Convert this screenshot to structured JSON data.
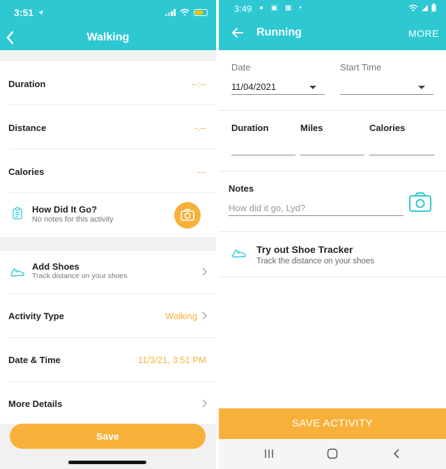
{
  "left_screen": {
    "status_time": "3:51",
    "title": "Walking",
    "rows": {
      "duration": {
        "label": "Duration",
        "value": "--:--"
      },
      "distance": {
        "label": "Distance",
        "value": "-.--"
      },
      "calories": {
        "label": "Calories",
        "value": "---"
      },
      "how": {
        "label": "How Did It Go?",
        "sub": "No notes for this activity"
      },
      "shoes": {
        "label": "Add Shoes",
        "sub": "Track distance on your shoes"
      },
      "activity_type": {
        "label": "Activity Type",
        "value": "Walking"
      },
      "date_time": {
        "label": "Date & Time",
        "value": "11/3/21, 3:51 PM"
      },
      "more_details": {
        "label": "More Details"
      }
    },
    "save_label": "Save"
  },
  "right_screen": {
    "status_time": "3:49",
    "title": "Running",
    "more_label": "MORE",
    "date": {
      "label": "Date",
      "value": "11/04/2021"
    },
    "start_time": {
      "label": "Start Time",
      "value": ""
    },
    "duration_label": "Duration",
    "miles_label": "Miles",
    "calories_label": "Calories",
    "notes": {
      "label": "Notes",
      "placeholder": "How did it go, Lyd?"
    },
    "shoe_tracker": {
      "title": "Try out Shoe Tracker",
      "sub": "Track the distance on your shoes"
    },
    "save_label": "SAVE ACTIVITY"
  },
  "colors": {
    "header": "#2ec8d3",
    "accent": "#f7b13a"
  },
  "icons": [
    "back-arrow-icon",
    "camera-icon",
    "clipboard-icon",
    "shoe-icon",
    "chevron-right-icon",
    "dropdown-arrow-icon",
    "wifi-icon",
    "battery-icon",
    "signal-icon"
  ]
}
